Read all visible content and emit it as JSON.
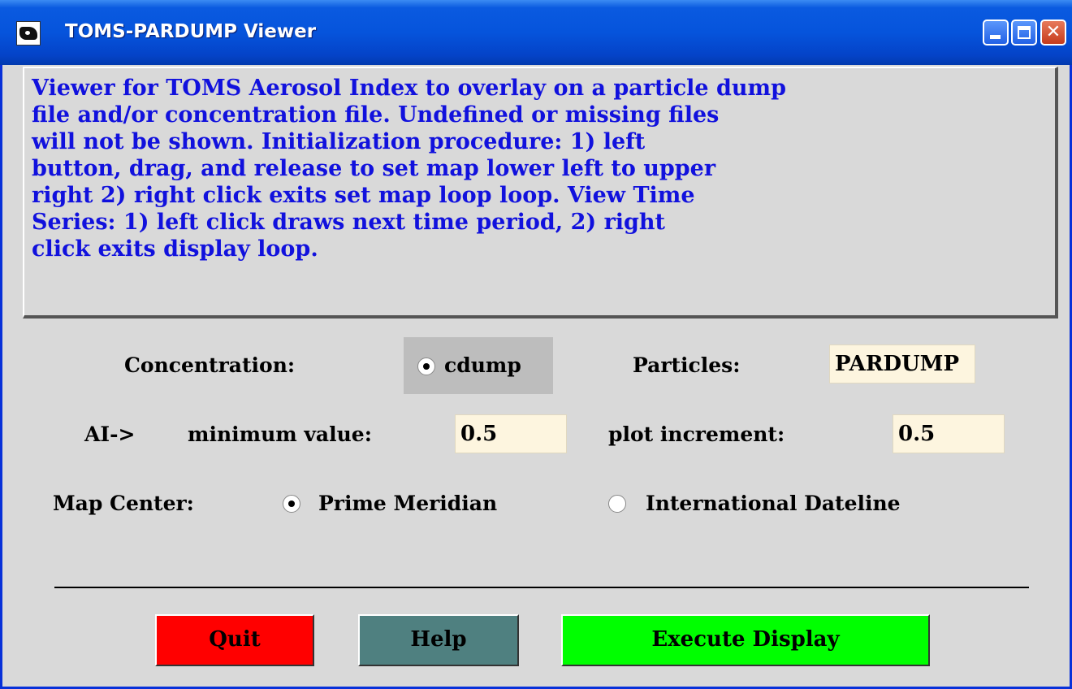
{
  "window": {
    "title": "TOMS-PARDUMP Viewer",
    "close_glyph": "✕",
    "icons": [
      "app-icon",
      "minimize-icon",
      "maximize-icon",
      "close-icon"
    ]
  },
  "description": "Viewer for TOMS Aerosol Index to overlay on a particle dump\nfile and/or concentration file. Undefined or missing files\nwill not be shown. Initialization procedure: 1) left\nbutton, drag, and release to set map lower left to upper\nright 2) right click exits set map loop loop. View Time\nSeries: 1) left click draws next time period, 2) right\nclick exits display loop.",
  "concentration": {
    "label": "Concentration:",
    "option": "cdump",
    "selected": true
  },
  "particles": {
    "label": "Particles:",
    "value": "PARDUMP"
  },
  "ai": {
    "prefix": "AI->",
    "min_label": "minimum value:",
    "min_value": "0.5",
    "inc_label": "plot increment:",
    "inc_value": "0.5"
  },
  "map_center": {
    "label": "Map Center:",
    "options": [
      "Prime Meridian",
      "International Dateline"
    ],
    "selected": "Prime Meridian"
  },
  "buttons": {
    "quit": "Quit",
    "help": "Help",
    "execute": "Execute Display"
  },
  "colors": {
    "title_bar": "#0654dc",
    "description_text": "#1111dd",
    "background": "#d9d9d9",
    "field": "#fdf5df",
    "quit": "#ff0000",
    "help": "#4f8080",
    "execute": "#00ff00"
  }
}
